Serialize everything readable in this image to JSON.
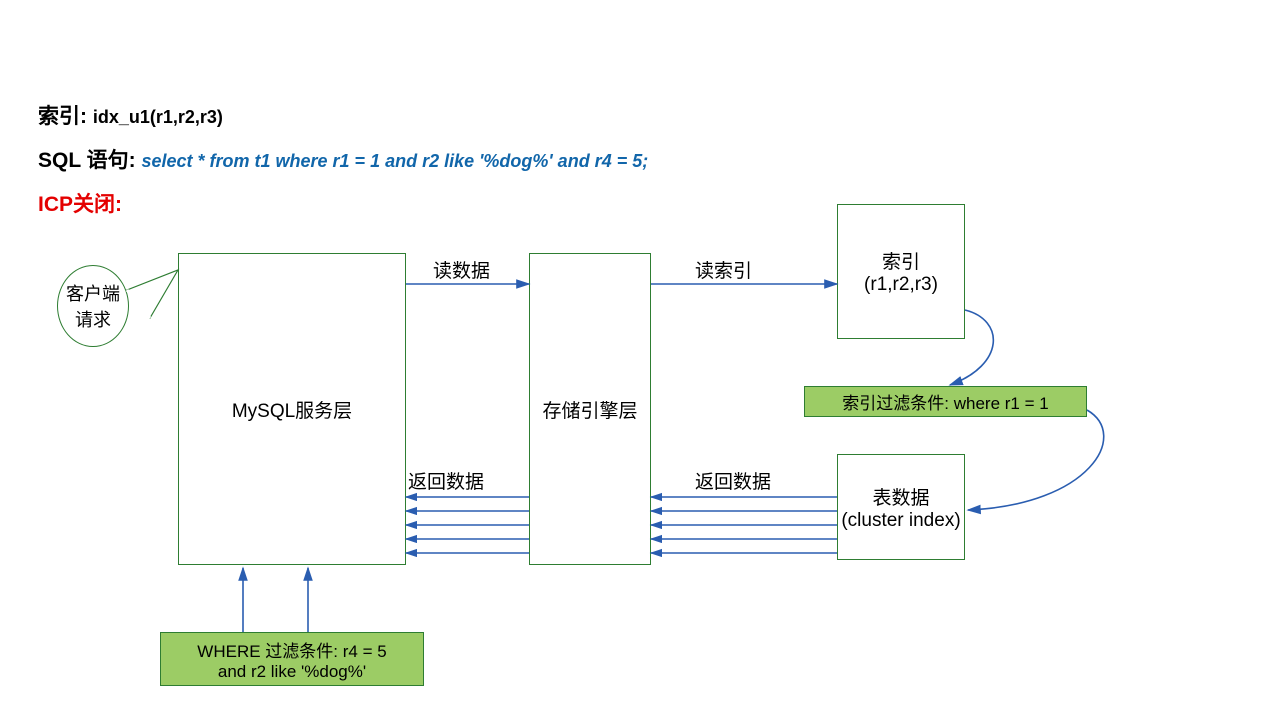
{
  "header": {
    "index_label": "索引:",
    "index_value": "idx_u1(r1,r2,r3)",
    "sql_label": "SQL 语句:",
    "sql_value": "select * from t1 where r1 = 1 and r2 like '%dog%' and r4 = 5;",
    "icp_off": "ICP关闭:"
  },
  "callout": "客户端请求",
  "boxes": {
    "mysql_layer": "MySQL服务层",
    "storage_layer": "存储引擎层",
    "index_box_l1": "索引",
    "index_box_l2": "(r1,r2,r3)",
    "table_box_l1": "表数据",
    "table_box_l2": "(cluster index)"
  },
  "labels": {
    "read_data": "读数据",
    "read_index": "读索引",
    "return_data1": "返回数据",
    "return_data2": "返回数据"
  },
  "green": {
    "index_filter": "索引过滤条件:  where r1 = 1",
    "where_filter_l1": "WHERE 过滤条件:  r4 = 5",
    "where_filter_l2": "and r2 like '%dog%'"
  }
}
